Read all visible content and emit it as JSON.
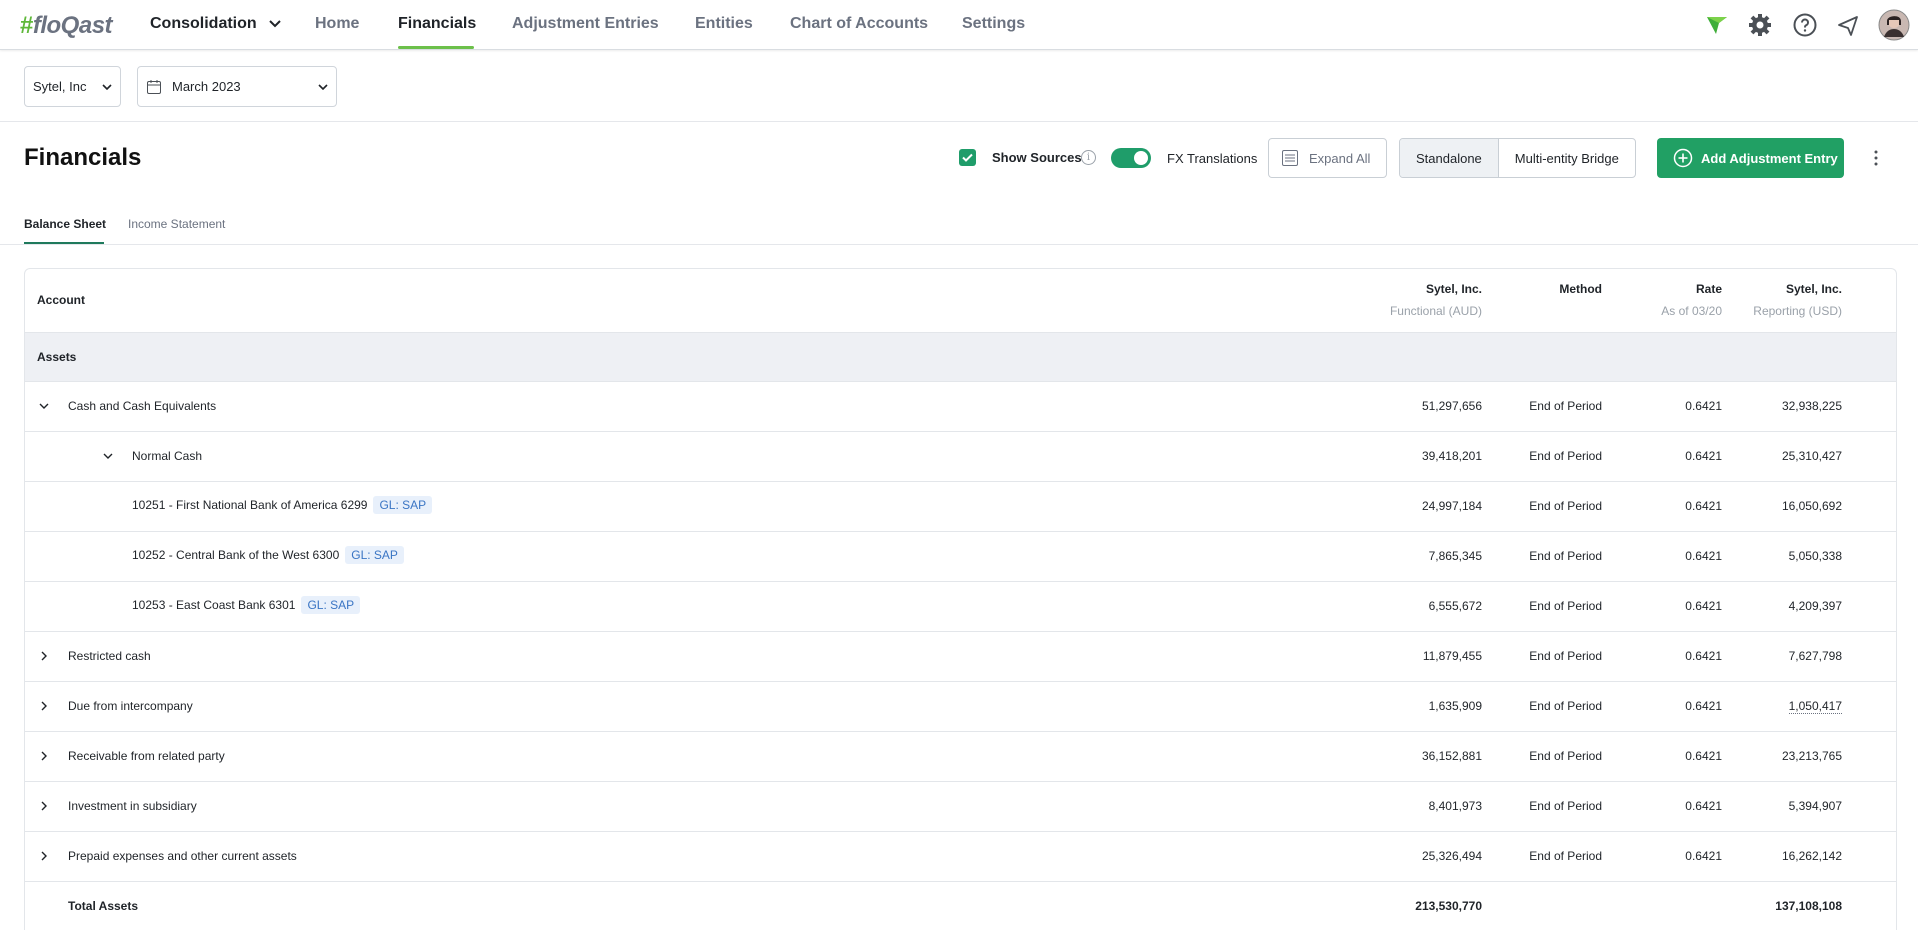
{
  "nav": {
    "logo_hash": "#",
    "logo_text": "floQast",
    "module": "Consolidation",
    "items": [
      "Home",
      "Financials",
      "Adjustment Entries",
      "Entities",
      "Chart of Accounts",
      "Settings"
    ],
    "active": "Financials"
  },
  "filters": {
    "entity": "Sytel, Inc",
    "period": "March 2023"
  },
  "header": {
    "title": "Financials",
    "show_sources": "Show Sources",
    "show_sources_checked": true,
    "fx_translations": "FX Translations",
    "fx_on": true,
    "expand_all": "Expand All",
    "view_standalone": "Standalone",
    "view_bridge": "Multi-entity Bridge",
    "add_entry": "Add Adjustment Entry"
  },
  "tabs": [
    "Balance Sheet",
    "Income Statement"
  ],
  "table": {
    "columns": {
      "account": "Account",
      "functional": "Sytel, Inc.",
      "functional_sub": "Functional (AUD)",
      "method": "Method",
      "rate": "Rate",
      "rate_sub": "As of 03/20",
      "reporting": "Sytel, Inc.",
      "reporting_sub": "Reporting (USD)"
    },
    "section": "Assets",
    "rows": [
      {
        "name": "Cash and Cash Equivalents",
        "functional": "51,297,656",
        "method": "End of Period",
        "rate": "0.6421",
        "reporting": "32,938,225"
      },
      {
        "name": "Normal Cash",
        "functional": "39,418,201",
        "method": "End of Period",
        "rate": "0.6421",
        "reporting": "25,310,427"
      },
      {
        "name": "10251 - First National Bank of America 6299",
        "gl": "GL: SAP",
        "functional": "24,997,184",
        "method": "End of Period",
        "rate": "0.6421",
        "reporting": "16,050,692"
      },
      {
        "name": "10252 - Central Bank of the West 6300",
        "gl": "GL: SAP",
        "functional": "7,865,345",
        "method": "End of Period",
        "rate": "0.6421",
        "reporting": "5,050,338"
      },
      {
        "name": "10253 - East Coast Bank 6301",
        "gl": "GL: SAP",
        "functional": "6,555,672",
        "method": "End of Period",
        "rate": "0.6421",
        "reporting": "4,209,397"
      },
      {
        "name": "Restricted cash",
        "functional": "11,879,455",
        "method": "End of Period",
        "rate": "0.6421",
        "reporting": "7,627,798"
      },
      {
        "name": "Due from intercompany",
        "functional": "1,635,909",
        "method": "End of Period",
        "rate": "0.6421",
        "reporting": "1,050,417"
      },
      {
        "name": "Receivable from related party",
        "functional": "36,152,881",
        "method": "End of Period",
        "rate": "0.6421",
        "reporting": "23,213,765"
      },
      {
        "name": "Investment in subsidiary",
        "functional": "8,401,973",
        "method": "End of Period",
        "rate": "0.6421",
        "reporting": "5,394,907"
      },
      {
        "name": "Prepaid expenses and other current assets",
        "functional": "25,326,494",
        "method": "End of Period",
        "rate": "0.6421",
        "reporting": "16,262,142"
      },
      {
        "name": "Total Assets",
        "functional": "213,530,770",
        "method": "",
        "rate": "",
        "reporting": "137,108,108"
      }
    ]
  },
  "colors": {
    "brand_green": "#5fb83a",
    "primary_button": "#21a064",
    "active_underline": "#6cc04a",
    "gl_badge_bg": "#e8f0fb",
    "gl_badge_text": "#3a75c4"
  }
}
